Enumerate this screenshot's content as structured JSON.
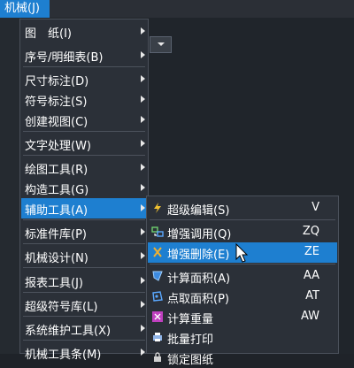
{
  "menubar": {
    "item_label": "机械(J)"
  },
  "menu": {
    "items": [
      {
        "label": "图　纸(I)"
      },
      {
        "label": "序号/明细表(B)"
      },
      {
        "label": "尺寸标注(D)"
      },
      {
        "label": "符号标注(S)"
      },
      {
        "label": "创建视图(C)"
      },
      {
        "label": "文字处理(W)"
      },
      {
        "label": "绘图工具(R)"
      },
      {
        "label": "构造工具(G)"
      },
      {
        "label": "辅助工具(A)"
      },
      {
        "label": "标准件库(P)"
      },
      {
        "label": "机械设计(N)"
      },
      {
        "label": "报表工具(J)"
      },
      {
        "label": "超级符号库(L)"
      },
      {
        "label": "系统维护工具(X)"
      },
      {
        "label": "机械工具条(M)"
      }
    ]
  },
  "submenu": {
    "items": [
      {
        "label": "超级编辑(S)",
        "shortcut": "V",
        "icon": "lightning-icon"
      },
      {
        "label": "增强调用(Q)",
        "shortcut": "ZQ",
        "icon": "call-icon"
      },
      {
        "label": "增强删除(E)",
        "shortcut": "ZE",
        "icon": "delete-icon"
      },
      {
        "label": "计算面积(A)",
        "shortcut": "AA",
        "icon": "area-icon"
      },
      {
        "label": "点取面积(P)",
        "shortcut": "AT",
        "icon": "pick-area-icon"
      },
      {
        "label": "计算重量",
        "shortcut": "AW",
        "icon": "weight-icon"
      },
      {
        "label": "批量打印",
        "shortcut": "",
        "icon": "print-icon"
      },
      {
        "label": "锁定图纸",
        "shortcut": "",
        "icon": "lock-icon"
      }
    ]
  },
  "colors": {
    "highlight": "#1e7fd0",
    "menu_bg": "#2b3038",
    "text": "#ffffff"
  }
}
